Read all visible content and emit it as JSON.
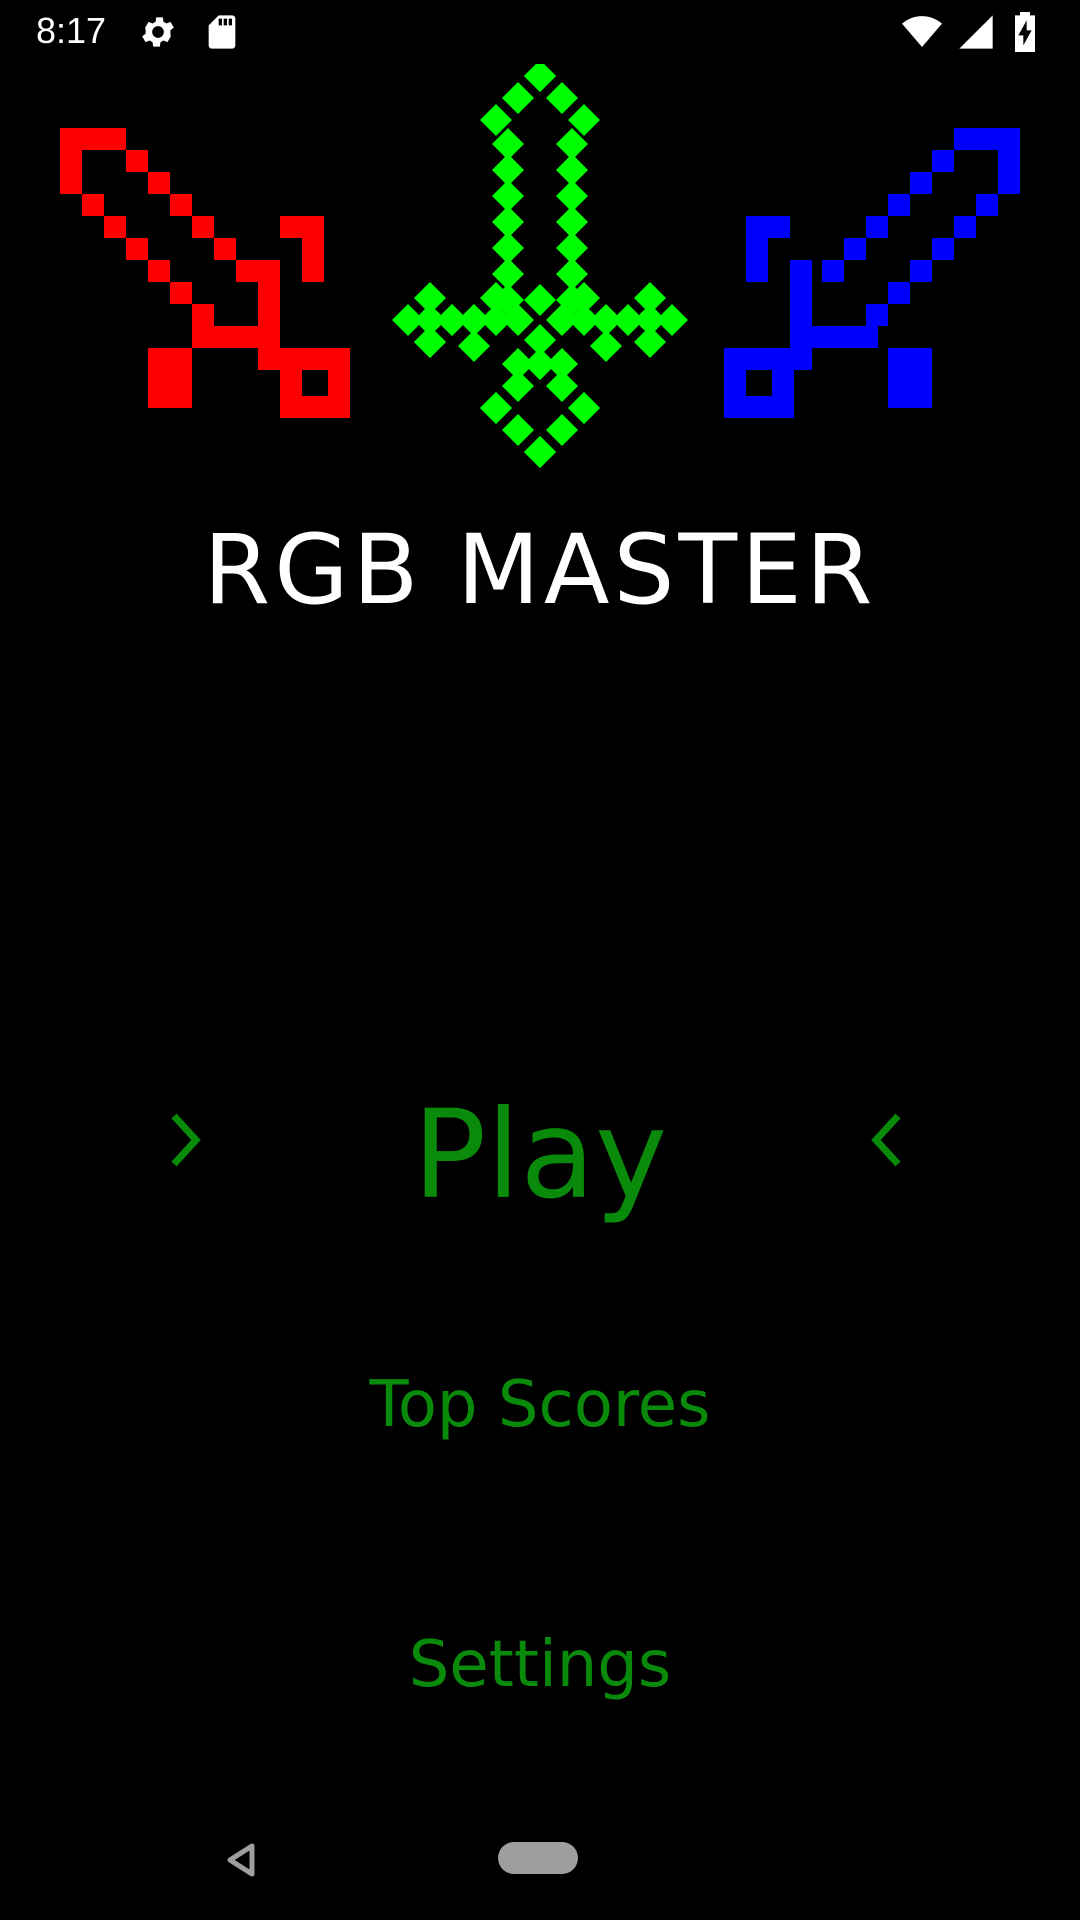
{
  "colors": {
    "menu": "#0a8a0a",
    "sword_left": "#ff0000",
    "sword_center": "#00ff00",
    "sword_right": "#0000ff"
  },
  "status_bar": {
    "time": "8:17",
    "icons": [
      "settings-gear-icon",
      "sd-card-icon",
      "wifi-icon",
      "cell-signal-icon",
      "battery-charging-icon"
    ]
  },
  "title": "RGB MASTER",
  "menu": {
    "play": "Play",
    "top_scores": "Top Scores",
    "settings": "Settings",
    "selector_left": "›",
    "selector_right": "‹"
  },
  "nav_bar": {
    "icons": [
      "back-triangle-icon",
      "home-pill-icon"
    ]
  }
}
